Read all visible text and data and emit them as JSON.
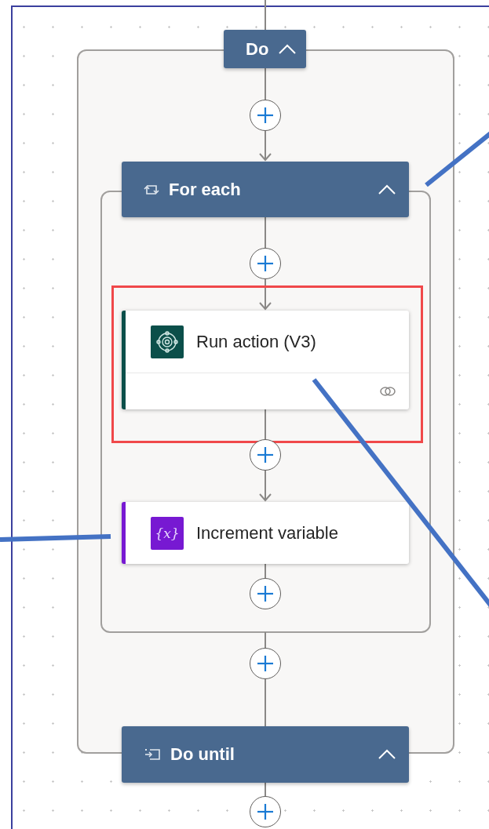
{
  "flow": [
    {
      "kind": "scope",
      "title": "Do",
      "expanded": true
    },
    {
      "kind": "scope",
      "title": "For each",
      "expanded": true
    },
    {
      "kind": "action",
      "title": "Run action (V3)",
      "color": "#0b4f4a",
      "highlighted": true,
      "connection_icon": true
    },
    {
      "kind": "action",
      "icon_label": "{x}",
      "title": "Increment variable",
      "color": "#7719d2",
      "highlighted": false,
      "connection_icon": false
    },
    {
      "kind": "scope",
      "title": "Do until",
      "expanded": true
    }
  ]
}
